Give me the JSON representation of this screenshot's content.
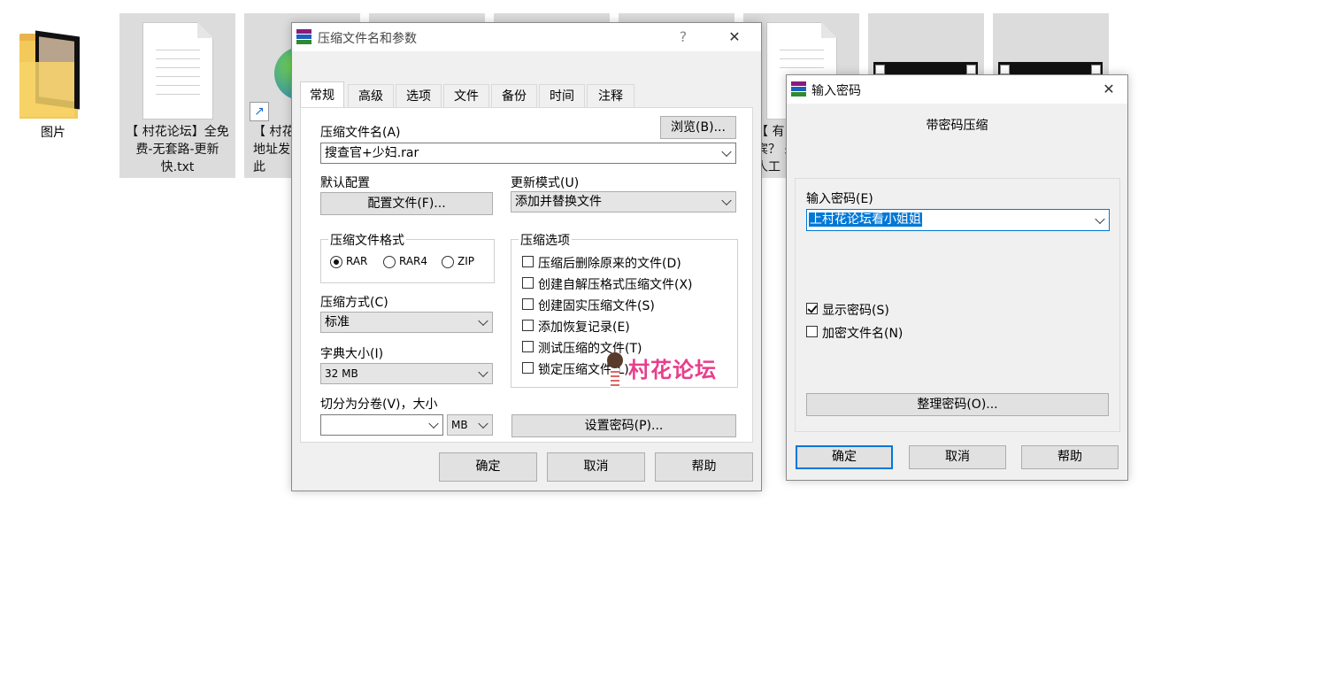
{
  "desktop": {
    "items": [
      {
        "label": "图片"
      },
      {
        "label": "【 村花论坛】全免费-无套路-更新快.txt"
      },
      {
        "label": "【 村花\n地址发\n此"
      },
      {
        "label": ""
      },
      {
        "label": ""
      },
      {
        "label": ""
      },
      {
        "label": "【 有\n宾？ 来\n人工"
      },
      {
        "label": ""
      },
      {
        "label": ""
      }
    ]
  },
  "archive_dialog": {
    "title": "压缩文件名和参数",
    "help_glyph": "?",
    "close_glyph": "✕",
    "tabs": [
      "常规",
      "高级",
      "选项",
      "文件",
      "备份",
      "时间",
      "注释"
    ],
    "archive_name_label": "压缩文件名(A)",
    "browse_button": "浏览(B)...",
    "archive_name_value": "搜查官+少妇.rar",
    "profile_label": "默认配置",
    "profile_button": "配置文件(F)...",
    "update_mode_label": "更新模式(U)",
    "update_mode_value": "添加并替换文件",
    "format_group": "压缩文件格式",
    "formats": [
      "RAR",
      "RAR4",
      "ZIP"
    ],
    "method_label": "压缩方式(C)",
    "method_value": "标准",
    "dict_label": "字典大小(I)",
    "dict_value": "32 MB",
    "split_label": "切分为分卷(V)，大小",
    "split_value": "",
    "split_unit": "MB",
    "options_group": "压缩选项",
    "options": [
      "压缩后删除原来的文件(D)",
      "创建自解压格式压缩文件(X)",
      "创建固实压缩文件(S)",
      "添加恢复记录(E)",
      "测试压缩的文件(T)",
      "锁定压缩文件(L)"
    ],
    "set_password_button": "设置密码(P)...",
    "ok_button": "确定",
    "cancel_button": "取消",
    "help_button": "帮助",
    "watermark": "村花论坛"
  },
  "password_dialog": {
    "title": "输入密码",
    "close_glyph": "✕",
    "heading": "带密码压缩",
    "password_label": "输入密码(E)",
    "password_value": "上村花论坛看小姐姐",
    "show_password_label": "显示密码(S)",
    "show_password_checked": true,
    "encrypt_names_label": "加密文件名(N)",
    "encrypt_names_checked": false,
    "organize_button": "整理密码(O)...",
    "ok_button": "确定",
    "cancel_button": "取消",
    "help_button": "帮助"
  }
}
